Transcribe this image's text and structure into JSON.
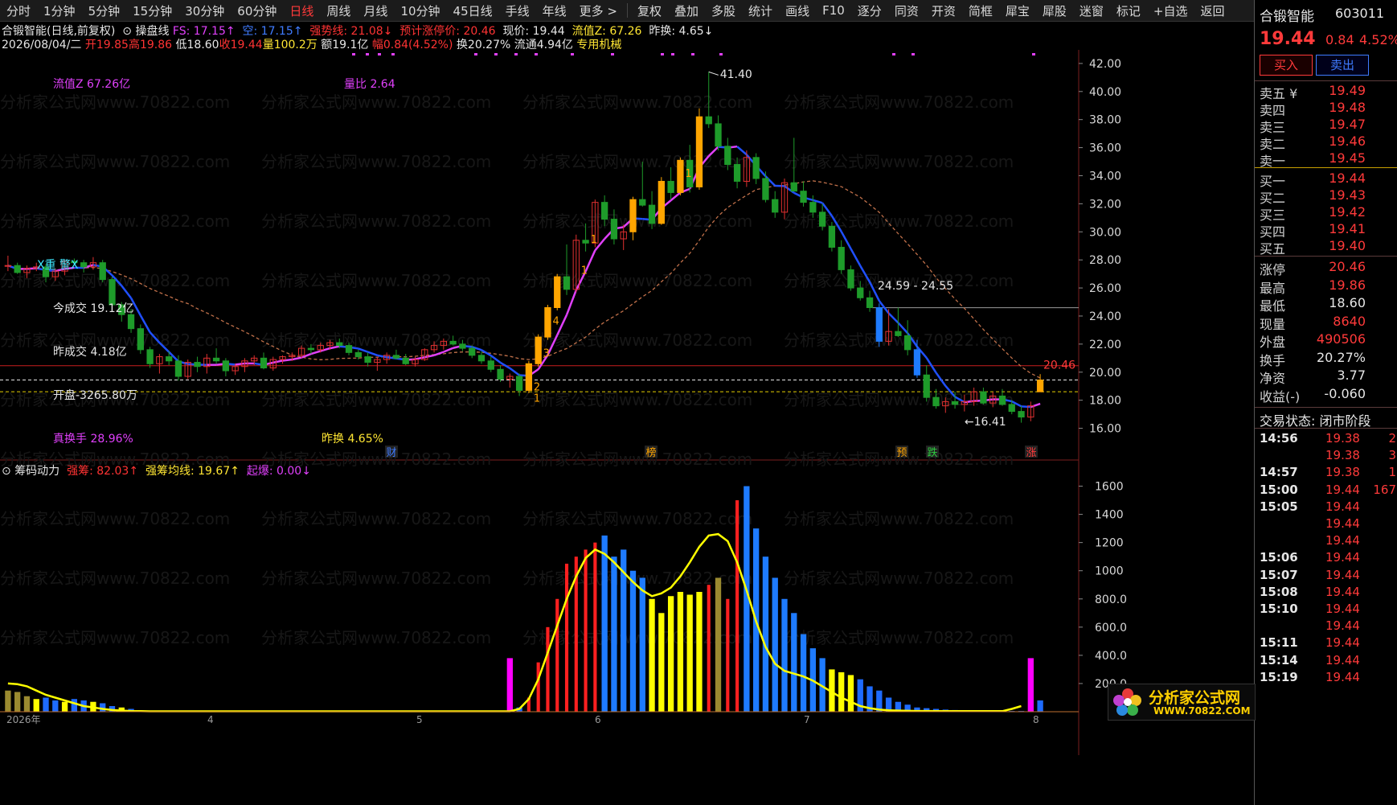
{
  "toolbar": {
    "items": [
      "分时",
      "1分钟",
      "5分钟",
      "15分钟",
      "30分钟",
      "60分钟",
      "日线",
      "周线",
      "月线",
      "10分钟",
      "45日线",
      "手线",
      "年线",
      "更多 >",
      "复权",
      "叠加",
      "多股",
      "统计",
      "画线",
      "F10",
      "逐分",
      "同资",
      "开资",
      "简框",
      "犀宝",
      "犀股",
      "迷窗",
      "标记",
      "+自选",
      "返回"
    ],
    "active": "日线"
  },
  "header": {
    "title": "合锻智能(日线,前复权)",
    "indicator_name": "操盘线",
    "fs": "FS: 17.15↑",
    "kong": "空: 17.15↑",
    "qiangshi": "强势线: 21.08↓",
    "yuji": "预计涨停价: 20.46",
    "xianjia": "现价: 19.44",
    "liutongz": "流值Z: 67.26",
    "zuohuan": "昨换: 4.65↓",
    "date": "2026/08/04/二",
    "open": "开19.85",
    "high": "高19.86",
    "low": "低18.60",
    "close": "收19.44",
    "vol": "量100.2万",
    "amount": "额19.1亿",
    "change": "幅0.84(4.52%)",
    "turnover": "换20.27%",
    "float": "流通4.94亿",
    "tag": "专用机械"
  },
  "annotations": {
    "liuzhiz": "流值Z 67.26亿",
    "liangbi": "量比 2.64",
    "zhongjing": "X重 警X",
    "jinchengjiao": "今成交 19.12亿",
    "zuochengjiao": "昨成交 4.18亿",
    "kaipan": "开盘-3265.80万",
    "zhenhuanshou": "真换手 28.96%",
    "zuohuan": "昨换 4.65%",
    "peak": "41.40",
    "trough": "16.41",
    "range": "24.59 - 24.55",
    "limit_price": "20.46",
    "badges": [
      "财",
      "榜",
      "预",
      "跌",
      "涨"
    ],
    "counts": [
      "1",
      "2",
      "3",
      "4",
      "1",
      "1",
      "1"
    ]
  },
  "indicator": {
    "name": "筹码动力",
    "qiangchou": "强筹: 82.03↑",
    "junxian": "强筹均线: 19.67↑",
    "qibao": "起爆: 0.00↓"
  },
  "xaxis": [
    "2026年",
    "4",
    "5",
    "6",
    "7",
    "8"
  ],
  "chart_data": [
    {
      "type": "candlestick",
      "title": "合锻智能(日线,前复权)",
      "ylim": [
        15,
        44
      ],
      "yticks": [
        16,
        18,
        20,
        22,
        24,
        26,
        28,
        30,
        32,
        34,
        36,
        38,
        40,
        42,
        44
      ],
      "ohlc": [
        [
          27.6,
          28.3,
          27.2,
          27.6
        ],
        [
          27.6,
          27.8,
          27.0,
          27.1
        ],
        [
          27.1,
          27.6,
          26.7,
          27.4
        ],
        [
          27.4,
          27.8,
          27.2,
          27.5
        ],
        [
          27.5,
          27.7,
          26.4,
          26.8
        ],
        [
          26.8,
          27.4,
          26.5,
          27.2
        ],
        [
          27.2,
          28.0,
          26.9,
          27.9
        ],
        [
          27.9,
          28.1,
          27.6,
          27.8
        ],
        [
          27.8,
          28.0,
          27.1,
          27.5
        ],
        [
          27.5,
          28.2,
          27.3,
          27.8
        ],
        [
          27.8,
          28.0,
          26.4,
          26.6
        ],
        [
          26.6,
          26.8,
          24.6,
          24.8
        ],
        [
          24.8,
          25.0,
          23.6,
          24.1
        ],
        [
          24.1,
          24.5,
          22.8,
          23.1
        ],
        [
          23.1,
          23.4,
          21.3,
          21.6
        ],
        [
          21.6,
          21.8,
          20.3,
          20.6
        ],
        [
          20.6,
          21.3,
          19.9,
          21.1
        ],
        [
          21.1,
          21.5,
          20.5,
          20.8
        ],
        [
          20.8,
          21.2,
          19.4,
          19.7
        ],
        [
          19.7,
          20.9,
          19.5,
          20.7
        ],
        [
          20.7,
          21.1,
          20.0,
          20.4
        ],
        [
          20.4,
          21.3,
          19.9,
          21.0
        ],
        [
          21.0,
          21.7,
          20.6,
          20.8
        ],
        [
          20.8,
          21.0,
          19.7,
          20.1
        ],
        [
          20.1,
          20.6,
          19.8,
          20.4
        ],
        [
          20.4,
          21.0,
          20.0,
          20.8
        ],
        [
          20.8,
          21.2,
          20.5,
          21.0
        ],
        [
          21.0,
          21.4,
          20.2,
          20.3
        ],
        [
          20.3,
          21.1,
          20.1,
          20.9
        ],
        [
          20.9,
          21.2,
          20.6,
          21.1
        ],
        [
          21.1,
          21.4,
          20.8,
          21.2
        ],
        [
          21.2,
          21.9,
          21.0,
          21.7
        ],
        [
          21.7,
          22.0,
          21.3,
          21.6
        ],
        [
          21.6,
          22.1,
          21.4,
          21.9
        ],
        [
          21.9,
          22.3,
          21.6,
          22.1
        ],
        [
          22.1,
          22.4,
          21.7,
          21.9
        ],
        [
          21.9,
          22.1,
          21.2,
          21.4
        ],
        [
          21.4,
          21.6,
          20.9,
          21.1
        ],
        [
          21.1,
          21.4,
          20.4,
          20.7
        ],
        [
          20.7,
          21.1,
          20.1,
          20.9
        ],
        [
          20.9,
          21.4,
          20.6,
          21.2
        ],
        [
          21.2,
          21.6,
          20.9,
          21.0
        ],
        [
          21.0,
          21.3,
          20.5,
          20.6
        ],
        [
          20.6,
          21.1,
          20.4,
          20.9
        ],
        [
          20.9,
          21.7,
          20.8,
          21.6
        ],
        [
          21.6,
          22.2,
          21.4,
          21.9
        ],
        [
          21.9,
          22.4,
          21.6,
          22.2
        ],
        [
          22.2,
          22.6,
          21.9,
          22.0
        ],
        [
          22.0,
          22.3,
          21.5,
          21.7
        ],
        [
          21.7,
          21.9,
          21.0,
          21.2
        ],
        [
          21.2,
          21.5,
          20.6,
          20.8
        ],
        [
          20.8,
          21.1,
          20.0,
          20.2
        ],
        [
          20.2,
          20.5,
          19.3,
          19.5
        ],
        [
          19.5,
          19.9,
          18.9,
          19.7
        ],
        [
          19.7,
          19.9,
          18.3,
          18.7
        ],
        [
          18.7,
          20.8,
          18.5,
          20.6
        ],
        [
          20.6,
          22.7,
          20.4,
          22.5
        ],
        [
          22.5,
          24.8,
          22.3,
          24.6
        ],
        [
          24.6,
          27.0,
          24.4,
          26.8
        ],
        [
          26.8,
          29.1,
          25.5,
          25.9
        ],
        [
          25.9,
          29.8,
          25.7,
          29.4
        ],
        [
          29.4,
          30.6,
          28.6,
          29.2
        ],
        [
          29.2,
          32.3,
          28.9,
          32.1
        ],
        [
          32.1,
          32.6,
          30.4,
          30.9
        ],
        [
          30.9,
          31.6,
          29.1,
          29.5
        ],
        [
          29.5,
          30.5,
          28.7,
          30.0
        ],
        [
          30.0,
          32.5,
          29.4,
          32.3
        ],
        [
          32.3,
          35.0,
          31.8,
          31.9
        ],
        [
          31.9,
          32.9,
          30.2,
          30.6
        ],
        [
          30.6,
          33.9,
          30.5,
          33.6
        ],
        [
          33.6,
          34.6,
          32.3,
          32.8
        ],
        [
          32.8,
          35.3,
          32.6,
          35.1
        ],
        [
          35.1,
          36.2,
          32.8,
          33.2
        ],
        [
          33.2,
          38.8,
          33.0,
          38.2
        ],
        [
          38.2,
          41.4,
          37.4,
          37.7
        ],
        [
          37.7,
          38.3,
          35.8,
          36.1
        ],
        [
          36.1,
          36.7,
          34.4,
          34.8
        ],
        [
          34.8,
          35.3,
          33.1,
          33.6
        ],
        [
          33.6,
          35.8,
          33.2,
          35.3
        ],
        [
          35.3,
          35.6,
          33.4,
          33.8
        ],
        [
          33.8,
          34.3,
          32.1,
          32.3
        ],
        [
          32.3,
          32.9,
          31.0,
          31.4
        ],
        [
          31.4,
          33.8,
          30.9,
          33.5
        ],
        [
          33.5,
          36.7,
          33.1,
          32.9
        ],
        [
          32.9,
          33.6,
          31.8,
          32.1
        ],
        [
          32.1,
          32.6,
          31.0,
          31.4
        ],
        [
          31.4,
          32.0,
          30.1,
          30.4
        ],
        [
          30.4,
          30.7,
          28.6,
          28.9
        ],
        [
          28.9,
          29.4,
          27.0,
          27.3
        ],
        [
          27.3,
          27.6,
          25.8,
          26.0
        ],
        [
          26.0,
          26.5,
          25.1,
          25.3
        ],
        [
          25.3,
          25.8,
          24.3,
          24.6
        ],
        [
          24.6,
          24.9,
          21.8,
          22.2
        ],
        [
          22.2,
          24.5,
          21.9,
          22.9
        ],
        [
          22.9,
          24.6,
          22.5,
          22.6
        ],
        [
          22.6,
          23.7,
          21.2,
          21.6
        ],
        [
          21.6,
          22.3,
          19.6,
          19.8
        ],
        [
          19.8,
          20.5,
          17.9,
          18.2
        ],
        [
          18.2,
          18.8,
          17.4,
          17.6
        ],
        [
          17.6,
          18.2,
          17.1,
          17.9
        ],
        [
          17.9,
          18.6,
          17.4,
          17.7
        ],
        [
          17.7,
          18.4,
          17.2,
          17.9
        ],
        [
          17.9,
          18.9,
          17.6,
          18.6
        ],
        [
          18.6,
          18.9,
          17.7,
          17.8
        ],
        [
          17.8,
          18.6,
          17.5,
          18.3
        ],
        [
          18.3,
          18.8,
          17.6,
          17.7
        ],
        [
          17.7,
          18.0,
          17.0,
          17.2
        ],
        [
          17.2,
          17.6,
          16.4,
          16.8
        ],
        [
          16.8,
          17.9,
          16.5,
          17.6
        ],
        [
          18.6,
          19.86,
          18.6,
          19.44
        ]
      ],
      "ma_fast_label": "操盘线",
      "ma_slow_label": "强势线",
      "hlines": [
        {
          "value": 20.46,
          "color": "#c81e1e"
        },
        {
          "value": 19.44,
          "color": "#e8e8e8"
        },
        {
          "value": 18.6,
          "color": "#e6d000"
        },
        {
          "value": 24.59,
          "color": "#9a9a9a"
        }
      ]
    },
    {
      "type": "bar",
      "title": "筹码动力",
      "ylim": [
        0,
        1700
      ],
      "yticks": [
        200,
        400,
        600,
        800,
        1000,
        1200,
        1400,
        1600
      ],
      "ytick_labels": [
        "200.0",
        "400.0",
        "600.0",
        "800.0",
        "1000",
        "1200",
        "1400",
        "1600"
      ],
      "values": [
        150,
        140,
        110,
        90,
        100,
        80,
        70,
        90,
        80,
        70,
        60,
        40,
        30,
        20,
        10,
        8,
        6,
        5,
        5,
        4,
        4,
        3,
        3,
        3,
        3,
        3,
        3,
        3,
        3,
        3,
        3,
        3,
        3,
        3,
        3,
        3,
        3,
        3,
        3,
        3,
        3,
        3,
        3,
        3,
        3,
        3,
        3,
        3,
        3,
        3,
        3,
        3,
        3,
        380,
        30,
        100,
        350,
        600,
        800,
        1050,
        1100,
        1150,
        1200,
        1250,
        1100,
        1150,
        1000,
        950,
        800,
        700,
        820,
        850,
        830,
        850,
        900,
        950,
        800,
        1500,
        1600,
        1300,
        1100,
        950,
        800,
        700,
        550,
        450,
        380,
        300,
        280,
        260,
        230,
        180,
        150,
        100,
        70,
        50,
        30,
        25,
        20,
        15,
        12,
        10,
        10,
        8,
        8,
        6,
        5,
        5,
        380,
        80
      ],
      "avg_line": [
        200,
        195,
        180,
        150,
        120,
        100,
        80,
        60,
        40,
        30,
        20,
        12,
        8,
        5,
        4,
        3,
        3,
        3,
        3,
        3,
        3,
        3,
        3,
        3,
        3,
        3,
        3,
        3,
        3,
        3,
        3,
        3,
        3,
        3,
        3,
        3,
        3,
        3,
        3,
        3,
        3,
        3,
        3,
        3,
        3,
        3,
        3,
        3,
        3,
        3,
        3,
        3,
        3,
        3,
        20,
        90,
        230,
        420,
        610,
        800,
        960,
        1090,
        1150,
        1120,
        1060,
        990,
        920,
        860,
        820,
        840,
        880,
        960,
        1060,
        1170,
        1250,
        1260,
        1210,
        1060,
        860,
        640,
        460,
        340,
        290,
        270,
        250,
        220,
        180,
        140,
        100,
        70,
        40,
        25,
        15,
        10,
        8,
        6,
        5,
        5,
        4,
        4,
        4,
        4,
        4,
        4,
        4,
        4,
        20,
        40
      ]
    }
  ],
  "right_panel": {
    "name": "合锻智能",
    "code": "603011",
    "price": "19.44",
    "chg": "0.84",
    "pct": "4.52%",
    "buy_btn": "买入",
    "sell_btn": "卖出",
    "asks": [
      [
        "卖五 ¥",
        "19.49"
      ],
      [
        "卖四",
        "19.48"
      ],
      [
        "卖三",
        "19.47"
      ],
      [
        "卖二",
        "19.46"
      ],
      [
        "卖一",
        "19.45"
      ]
    ],
    "bids": [
      [
        "买一",
        "19.44"
      ],
      [
        "买二",
        "19.43"
      ],
      [
        "买三",
        "19.42"
      ],
      [
        "买四",
        "19.41"
      ],
      [
        "买五",
        "19.40"
      ]
    ],
    "stats": [
      [
        "涨停",
        "20.46",
        "#ff3a3a"
      ],
      [
        "最高",
        "19.86",
        "#ff3a3a"
      ],
      [
        "最低",
        "18.60",
        "#e6e6e6"
      ],
      [
        "现量",
        "8640",
        "#ff3a3a"
      ],
      [
        "外盘",
        "490506",
        "#ff3a3a"
      ],
      [
        "换手",
        "20.27%",
        "#e6e6e6"
      ],
      [
        "净资",
        "3.77",
        "#e6e6e6"
      ],
      [
        "收益(-)",
        "-0.060",
        "#e6e6e6"
      ]
    ],
    "status": "交易状态: 闭市阶段",
    "ticks": [
      [
        "14:56",
        "19.38",
        "2"
      ],
      [
        "",
        "19.38",
        "3"
      ],
      [
        "14:57",
        "19.38",
        "1"
      ],
      [
        "15:00",
        "19.44",
        "167"
      ],
      [
        "15:05",
        "19.44",
        ""
      ],
      [
        "",
        "19.44",
        ""
      ],
      [
        "",
        "19.44",
        ""
      ],
      [
        "15:06",
        "19.44",
        ""
      ],
      [
        "15:07",
        "19.44",
        ""
      ],
      [
        "15:08",
        "19.44",
        ""
      ],
      [
        "15:10",
        "19.44",
        ""
      ],
      [
        "",
        "19.44",
        ""
      ],
      [
        "15:11",
        "19.44",
        ""
      ],
      [
        "15:14",
        "19.44",
        ""
      ],
      [
        "15:19",
        "19.44",
        ""
      ]
    ]
  },
  "logo": {
    "text": "分析家公式网",
    "url": "WWW.70822.COM"
  },
  "watermark": "分析家公式网www.70822.com"
}
